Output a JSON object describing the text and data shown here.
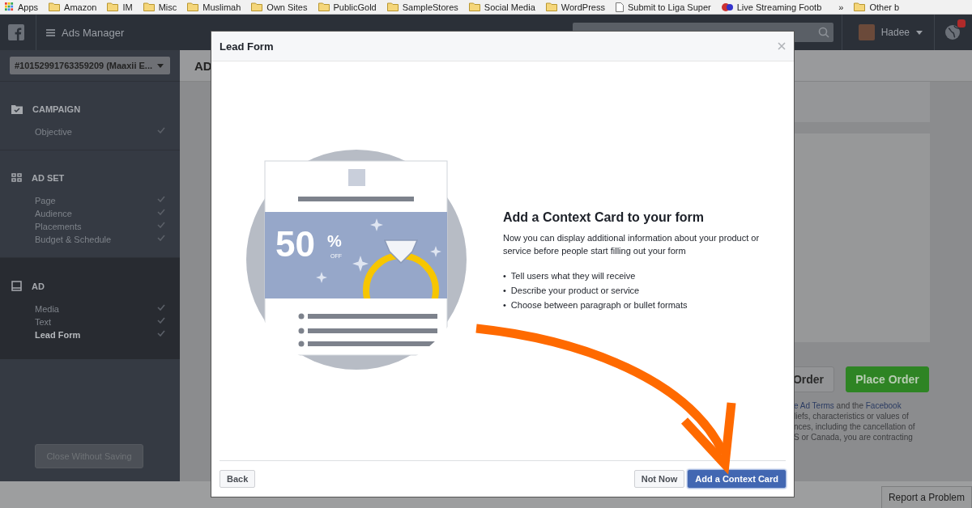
{
  "bookmarks": [
    {
      "label": "Apps",
      "kind": "apps"
    },
    {
      "label": "Amazon",
      "kind": "folder"
    },
    {
      "label": "IM",
      "kind": "folder"
    },
    {
      "label": "Misc",
      "kind": "folder"
    },
    {
      "label": "Muslimah",
      "kind": "folder"
    },
    {
      "label": "Own Sites",
      "kind": "folder"
    },
    {
      "label": "PublicGold",
      "kind": "folder"
    },
    {
      "label": "SampleStores",
      "kind": "folder"
    },
    {
      "label": "Social Media",
      "kind": "folder"
    },
    {
      "label": "WordPress",
      "kind": "folder"
    },
    {
      "label": "Submit to Liga Super",
      "kind": "page"
    },
    {
      "label": "Live Streaming Footb",
      "kind": "site"
    },
    {
      "label": "»",
      "kind": "more"
    },
    {
      "label": "Other b",
      "kind": "folder"
    }
  ],
  "top_bar": {
    "app_title": "Ads Manager",
    "user_name": "Hadee"
  },
  "account_selector": "#10152991763359209 (Maaxii E...",
  "sidebar": {
    "sections": [
      {
        "title": "CAMPAIGN",
        "kind": "campaign",
        "active": false,
        "items": [
          {
            "label": "Objective",
            "selected": false
          }
        ]
      },
      {
        "title": "AD SET",
        "kind": "adset",
        "active": false,
        "items": [
          {
            "label": "Page",
            "selected": false
          },
          {
            "label": "Audience",
            "selected": false
          },
          {
            "label": "Placements",
            "selected": false
          },
          {
            "label": "Budget & Schedule",
            "selected": false
          }
        ]
      },
      {
        "title": "AD",
        "kind": "ad",
        "active": true,
        "items": [
          {
            "label": "Media",
            "selected": false
          },
          {
            "label": "Text",
            "selected": false
          },
          {
            "label": "Lead Form",
            "selected": true
          }
        ]
      }
    ],
    "close_button": "Close Without Saving"
  },
  "main": {
    "heading": "AD",
    "buttons": [
      {
        "label": "Order",
        "kind": "secondary"
      },
      {
        "label": "Place Order",
        "kind": "primary"
      }
    ],
    "terms_lines": [
      {
        "parts": [
          {
            "text": "e Ad Terms",
            "link": true
          },
          {
            "text": " and the ",
            "link": false
          },
          {
            "text": "Facebook",
            "link": true
          }
        ]
      },
      {
        "parts": [
          {
            "text": "liefs, characteristics or values of",
            "link": false
          }
        ]
      },
      {
        "parts": [
          {
            "text": "nces, including the cancellation of",
            "link": false
          }
        ]
      },
      {
        "parts": [
          {
            "text": "S or Canada, you are contracting",
            "link": false
          }
        ]
      }
    ],
    "report_button": "Report a Problem"
  },
  "modal": {
    "title": "Lead Form",
    "illustration": {
      "number": "50",
      "percent": "%",
      "off": "OFF"
    },
    "heading": "Add a Context Card to your form",
    "description": "Now you can display additional information about your product or service before people start filling out your form",
    "bullets": [
      {
        "marker": "•",
        "text": "Tell users what they will receive"
      },
      {
        "marker": "•",
        "text": "Describe your product or service"
      },
      {
        "marker": "•",
        "text": "Choose between paragraph or bullet formats"
      }
    ],
    "buttons": [
      {
        "label": "Back",
        "kind": "secondary"
      },
      {
        "label": "Not Now",
        "kind": "secondary"
      },
      {
        "label": "Add a Context Card",
        "kind": "primary"
      }
    ]
  }
}
